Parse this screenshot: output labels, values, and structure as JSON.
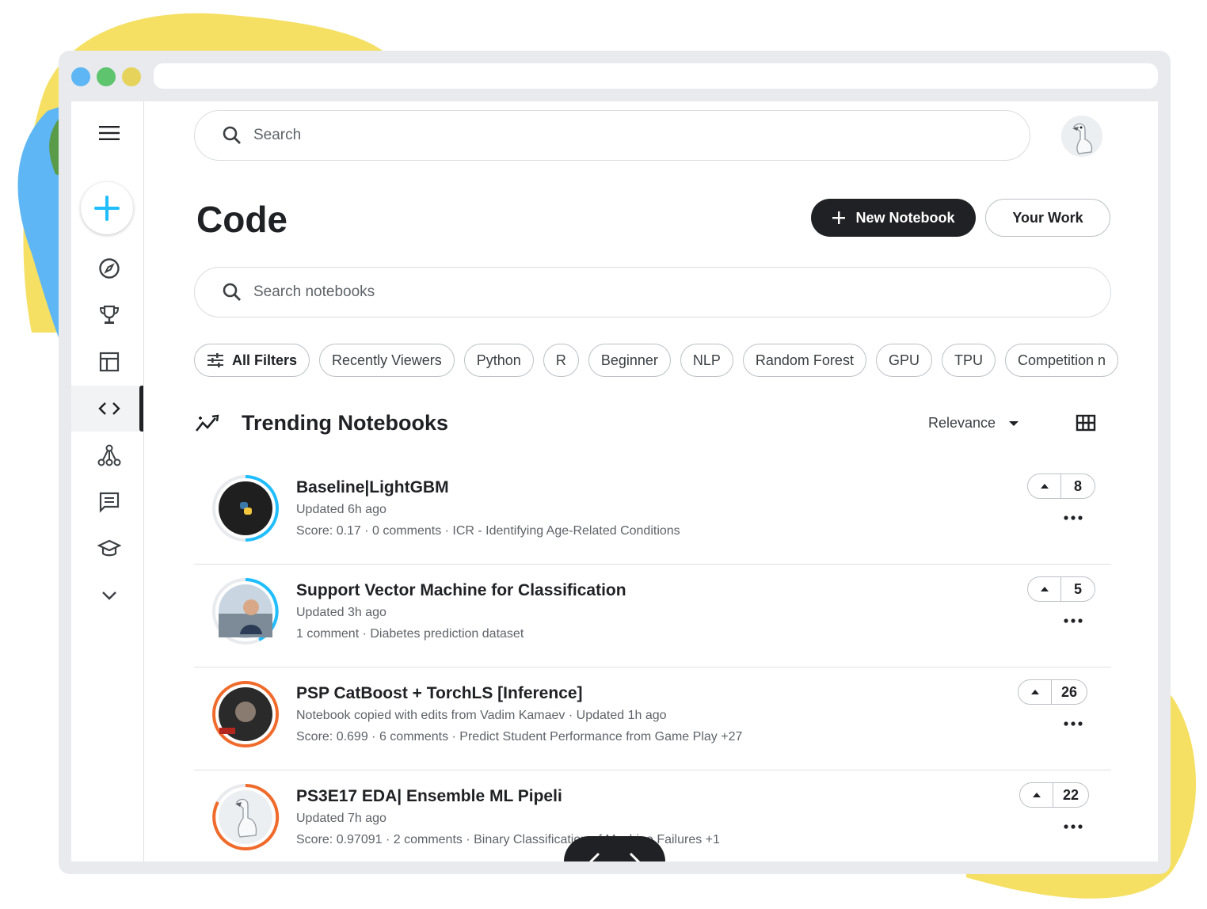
{
  "colors": {
    "yellow": "#f5e063",
    "blue": "#5eb6f4",
    "green": "#5a9b4a",
    "accent_blue": "#20beff",
    "orange": "#f06b2b",
    "dark": "#202124"
  },
  "search": {
    "placeholder": "Search"
  },
  "page": {
    "title": "Code"
  },
  "actions": {
    "new_notebook": "New Notebook",
    "your_work": "Your Work"
  },
  "notebook_search": {
    "placeholder": "Search notebooks"
  },
  "filters": {
    "all": "All Filters",
    "chips": [
      "Recently Viewers",
      "Python",
      "R",
      "Beginner",
      "NLP",
      "Random Forest",
      "GPU",
      "TPU",
      "Competition n"
    ]
  },
  "section": {
    "title": "Trending Notebooks",
    "sort_label": "Relevance"
  },
  "notebooks": [
    {
      "title": "Baseline|LightGBM",
      "subtitle": "Updated 6h ago",
      "meta": "Score: 0.17 · 0 comments · ICR - Identifying Age-Related Conditions",
      "votes": "8",
      "ring": "blue",
      "avatar": "python-logo-icon"
    },
    {
      "title": "Support Vector Machine for Classification",
      "subtitle": "Updated 3h ago",
      "meta": "1 comment · Diabetes prediction dataset",
      "votes": "5",
      "ring": "blue",
      "avatar": "user-photo"
    },
    {
      "title": "PSP CatBoost + TorchLS [Inference]",
      "subtitle": "Notebook copied with edits from Vadim Kamaev · Updated 1h ago",
      "meta": "Score: 0.699 · 6 comments · Predict Student Performance from Game Play +27",
      "votes": "26",
      "ring": "orange",
      "avatar": "user-photo"
    },
    {
      "title": "PS3E17 EDA| Ensemble ML Pipeli",
      "subtitle": "Updated 7h ago",
      "meta": "Score: 0.97091 · 2 comments · Binary Classification of Machine Failures +1",
      "votes": "22",
      "ring": "orange",
      "avatar": "goose-avatar"
    }
  ],
  "sidebar": {
    "items": [
      "menu-icon",
      "create-icon",
      "compass-icon",
      "trophy-icon",
      "table-icon",
      "code-icon",
      "models-icon",
      "comments-icon",
      "learn-icon",
      "expand-icon"
    ],
    "active": "code-icon"
  }
}
